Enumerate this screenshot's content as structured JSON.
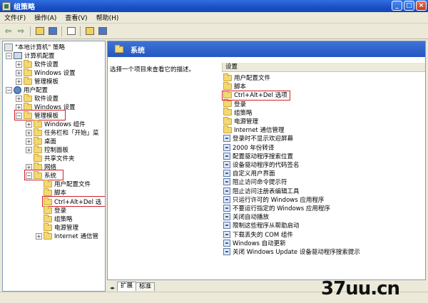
{
  "window": {
    "title": "组策略",
    "minimize": "_",
    "maximize": "□",
    "close": "×"
  },
  "menu": [
    "文件(F)",
    "操作(A)",
    "查看(V)",
    "帮助(H)"
  ],
  "toolbar": {
    "back_glyph": "⇦",
    "forward_glyph": "⇨"
  },
  "tree": {
    "root": "\"本地计算机\" 策略",
    "computer_config": "计算机配置",
    "cc_software": "软件设置",
    "cc_windows": "Windows 设置",
    "cc_admin": "管理模板",
    "user_config": "用户配置",
    "uc_software": "软件设置",
    "uc_windows": "Windows 设置",
    "uc_admin": "管理模板",
    "windows_components": "Windows 组件",
    "taskbar": "任务栏和「开始」菜",
    "desktop": "桌面",
    "control_panel": "控制面板",
    "shared_folders": "共享文件夹",
    "network": "网络",
    "system": "系统",
    "user_profiles": "用户配置文件",
    "scripts": "脚本",
    "ctrl_alt_del": "Ctrl+Alt+Del 选",
    "logon": "登录",
    "group_policy": "组策略",
    "power": "电源管理",
    "internet_comm": "Internet 通信管"
  },
  "right": {
    "header": "系统",
    "description": "选择一个项目来查看它的描述。",
    "column_header": "设置",
    "folders": [
      "用户配置文件",
      "脚本",
      "Ctrl+Alt+Del 选项",
      "登录",
      "组策略",
      "电源管理",
      "Internet 通信管理"
    ],
    "settings": [
      "登录时不显示欢迎屏幕",
      "2000 年份转译",
      "配置驱动程序搜索位置",
      "设备驱动程序的代码签名",
      "自定义用户界面",
      "阻止访问命令提示符",
      "阻止访问注册表编辑工具",
      "只运行许可的 Windows 应用程序",
      "不要运行指定的 Windows 应用程序",
      "关闭自动播放",
      "限制这些程序从帮助启动",
      "下载丢失的 COM 组件",
      "Windows 自动更新",
      "关闭 Windows Update 设备驱动程序搜索提示"
    ]
  },
  "tabs": {
    "arrows": "◂▸",
    "extended": "扩展",
    "standard": "标准"
  },
  "watermark": "37uu.cn",
  "colors": {
    "titlebar": "#1a4fc5",
    "header": "#2f63cc",
    "highlight": "#d0202a"
  }
}
